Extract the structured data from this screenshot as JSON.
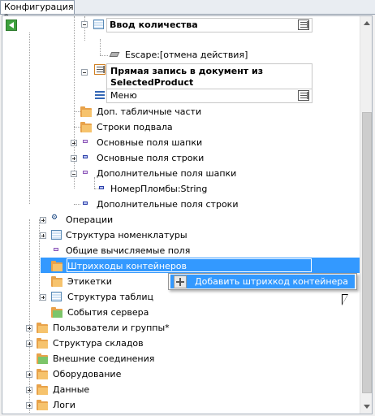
{
  "window": {
    "tab_title": "Конфигурация *"
  },
  "tree": {
    "input_quantity": "Ввод количества",
    "escape": "Escape:[отмена действия]",
    "direct_write_line1": "Прямая запись в документ из",
    "direct_write_line2": "SelectedProduct",
    "menu": "Меню",
    "extra_table_parts": "Доп. табличные части",
    "footer_rows": "Строки подвала",
    "main_header_fields": "Основные поля шапки",
    "main_row_fields": "Основные поля строки",
    "extra_header_fields": "Дополнительные поля шапки",
    "seal_number": "НомерПломбы:String",
    "extra_row_fields": "Дополнительные поля строки",
    "operations": "Операции",
    "nomenclature_structure": "Структура номенклатуры",
    "common_computed_fields": "Общие вычисляемые поля",
    "container_barcodes": "Штрихкоды контейнеров",
    "labels": "Этикетки",
    "table_structure": "Структура таблиц",
    "server_events": "События сервера",
    "users_groups": "Пользователи и группы*",
    "warehouse_structure": "Структура складов",
    "external_connections": "Внешние соединения",
    "equipment": "Оборудование",
    "data": "Данные",
    "logs": "Логи"
  },
  "context_menu": {
    "add_container_barcode": "Добавить штрихкод контейнера"
  },
  "colors": {
    "selection": "#3399ff",
    "folder": "#e8a24a"
  }
}
